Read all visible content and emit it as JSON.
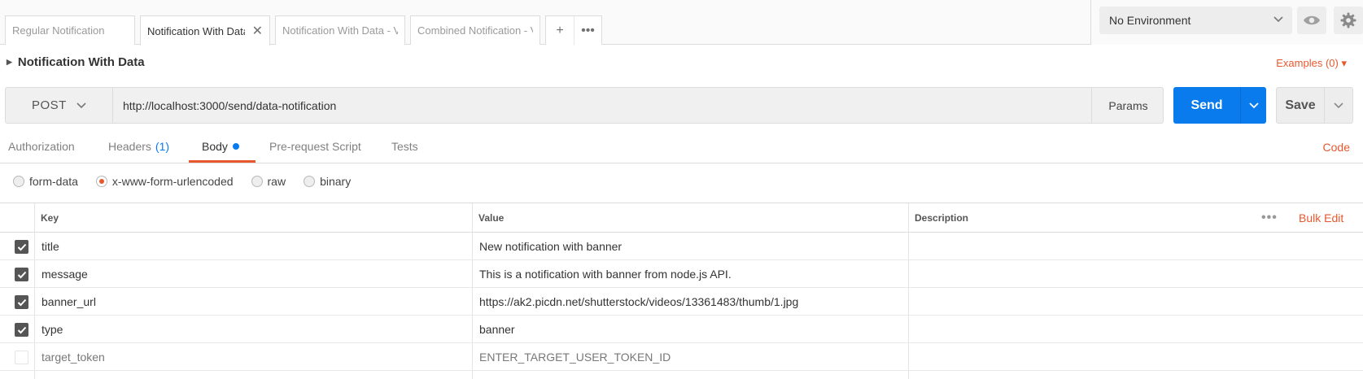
{
  "tabs": [
    {
      "label": "Regular Notification",
      "active": false
    },
    {
      "label": "Notification With Data",
      "active": true
    },
    {
      "label": "Notification With Data - VIP",
      "active": false
    },
    {
      "label": "Combined Notification - VIP",
      "active": false
    }
  ],
  "tab_actions": {
    "add_icon": "plus-icon",
    "more_icon": "more-horizontal-icon"
  },
  "environment": {
    "selected": "No Environment"
  },
  "request": {
    "name": "Notification With Data",
    "examples_label": "Examples (0)",
    "method": "POST",
    "url": "http://localhost:3000/send/data-notification",
    "params_label": "Params",
    "send_label": "Send",
    "save_label": "Save"
  },
  "request_tabs": [
    {
      "label": "Authorization"
    },
    {
      "label": "Headers",
      "count": "(1)"
    },
    {
      "label": "Body",
      "active": true
    },
    {
      "label": "Pre-request Script"
    },
    {
      "label": "Tests"
    }
  ],
  "code_label": "Code",
  "body_types": [
    {
      "label": "form-data",
      "selected": false
    },
    {
      "label": "x-www-form-urlencoded",
      "selected": true
    },
    {
      "label": "raw",
      "selected": false
    },
    {
      "label": "binary",
      "selected": false
    }
  ],
  "table": {
    "headers": {
      "key": "Key",
      "value": "Value",
      "description": "Description"
    },
    "bulk_edit_label": "Bulk Edit",
    "rows": [
      {
        "key": "title",
        "value": "New notification with banner",
        "checked": true
      },
      {
        "key": "message",
        "value": "This is a notification with banner from node.js API.",
        "checked": true
      },
      {
        "key": "banner_url",
        "value": "https://ak2.picdn.net/shutterstock/videos/13361483/thumb/1.jpg",
        "checked": true
      },
      {
        "key": "type",
        "value": "banner",
        "checked": true
      },
      {
        "key": "target_token",
        "value": "ENTER_TARGET_USER_TOKEN_ID",
        "checked": false
      }
    ]
  },
  "colors": {
    "accent": "#e8582f",
    "send": "#097bed"
  }
}
